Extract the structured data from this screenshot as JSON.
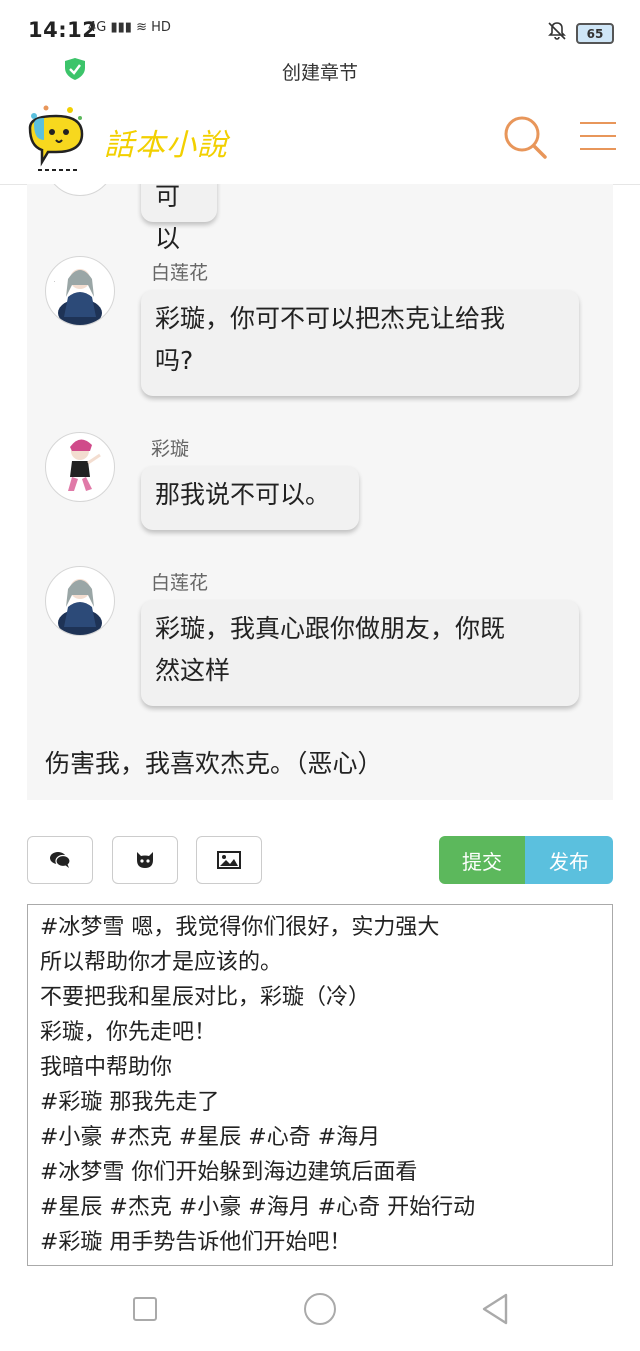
{
  "status_bar": {
    "time": "14:12",
    "network_icons": "4G ▮▮▮ ≋ HD",
    "battery": "65"
  },
  "titlebar": {
    "title": "创建章节"
  },
  "header": {
    "logo_text": "話本小說",
    "search_icon": "search-icon",
    "menu_icon": "hamburger-menu-icon"
  },
  "chat": {
    "partial_bubble": "可以",
    "messages": [
      {
        "speaker": "白莲花",
        "lines": [
          "彩璇，你可不可以把杰克让给我",
          "吗?"
        ]
      },
      {
        "speaker": "彩璇",
        "lines": [
          "那我说不可以。"
        ]
      },
      {
        "speaker": "白莲花",
        "lines": [
          "彩璇，我真心跟你做朋友，你既",
          "然这样"
        ]
      }
    ],
    "narration": "伤害我，我喜欢杰克。（恶心）"
  },
  "toolbar": {
    "comment_icon": "comment-icon",
    "character_icon": "github-cat-icon",
    "image_icon": "image-icon",
    "submit_label": "提交",
    "publish_label": "发布",
    "submit_color": "#5cb85c",
    "publish_color": "#5bc0de"
  },
  "editor": {
    "lines": [
      "#冰梦雪 嗯，我觉得你们很好，实力强大",
      "所以帮助你才是应该的。",
      "不要把我和星辰对比，彩璇（冷）",
      "彩璇，你先走吧！",
      "我暗中帮助你",
      "#彩璇 那我先走了",
      "#小豪 #杰克 #星辰 #心奇 #海月",
      "#冰梦雪 你们开始躲到海边建筑后面看",
      "#星辰 #杰克 #小豪 #海月 #心奇 开始行动",
      "#彩璇 用手势告诉他们开始吧！"
    ]
  },
  "colors": {
    "accent_orange": "#e8965a",
    "chat_bg": "#f6f6f6"
  }
}
